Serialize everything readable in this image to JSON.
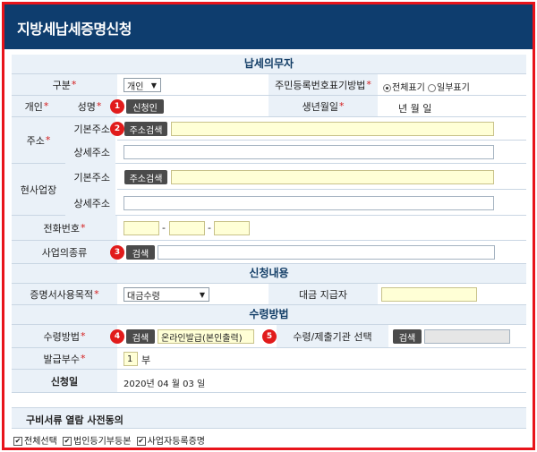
{
  "page": {
    "title": "지방세납세증명신청"
  },
  "sections": {
    "taxpayer": "납세의무자",
    "application": "신청내용",
    "receipt": "수령방법",
    "consent": "구비서류 열람 사전동의"
  },
  "taxpayer": {
    "type_label": "구분",
    "type_value": "개인",
    "id_display_label": "주민등록번호표기방법",
    "id_display_options": [
      "전체표기",
      "일부표기"
    ],
    "individual_label": "개인",
    "name_label": "성명",
    "applicant_button": "신청인",
    "birth_label": "생년월일",
    "birth_value": "년   월   일",
    "address_label": "주소",
    "basic_address_label": "기본주소",
    "detail_address_label": "상세주소",
    "address_search_button": "주소검색",
    "workplace_label": "현사업장",
    "phone_label": "전화번호",
    "phone_sep": "-",
    "business_type_label": "사업의종류",
    "search_button": "검색"
  },
  "application": {
    "purpose_label": "증명서사용목적",
    "purpose_value": "대금수령",
    "payer_label": "대금 지급자"
  },
  "receipt": {
    "method_label": "수령방법",
    "search_button": "검색",
    "method_value": "온라인발급(본인출력)",
    "agency_label": "수령/제출기관 선택",
    "agency_search_button": "검색",
    "copies_label": "발급부수",
    "copies_value": "1",
    "copies_unit": "부",
    "date_label": "신청일",
    "date_value": "2020년 04   월 03   일"
  },
  "consent": {
    "items": [
      "전체선택",
      "법인등기부등본",
      "사업자등록증명"
    ]
  },
  "markers": [
    "1",
    "2",
    "3",
    "4",
    "5"
  ],
  "colors": {
    "title_bar": "#0e3d6e",
    "border": "#e8141b",
    "marker": "#e11b1b",
    "label_bg": "#eaf1f8"
  }
}
